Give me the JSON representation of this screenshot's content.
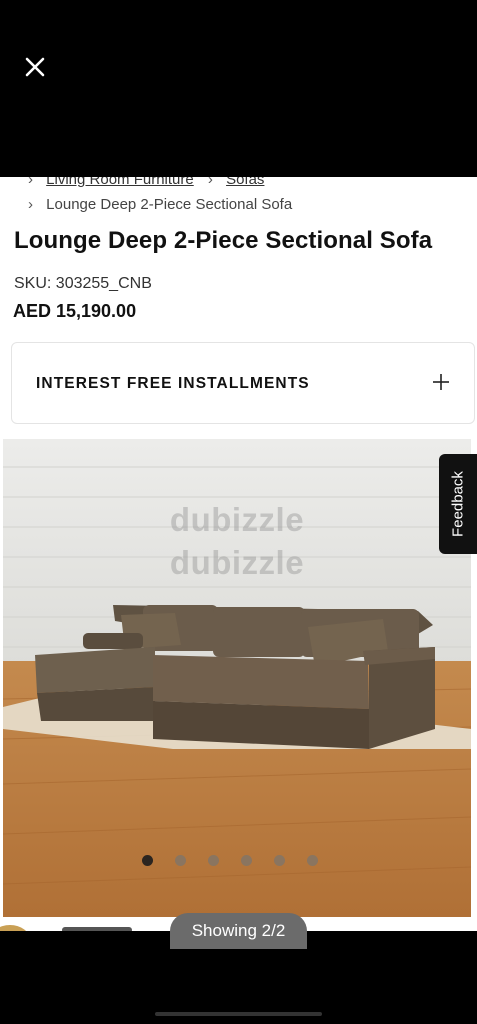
{
  "viewer": {
    "close_icon": "close-icon",
    "showing_label": "Showing 2/2"
  },
  "breadcrumb": {
    "items": [
      "Living Room Furniture",
      "Sofas",
      "Lounge Deep 2-Piece Sectional Sofa"
    ],
    "separator_icon": "chevron-right-icon"
  },
  "product": {
    "title": "Lounge Deep 2-Piece Sectional Sofa",
    "sku": "SKU: 303255_CNB",
    "price": "AED 15,190.00",
    "installments_label": "INTEREST FREE INSTALLMENTS",
    "installments_icon": "plus-icon",
    "watermark": "dubizzle"
  },
  "gallery": {
    "dot_count": 6,
    "active_index": 0
  },
  "feedback": {
    "label": "Feedback"
  },
  "colors": {
    "background": "#000000",
    "page": "#ffffff",
    "text": "#111111",
    "pill": "#6b6b6b"
  }
}
